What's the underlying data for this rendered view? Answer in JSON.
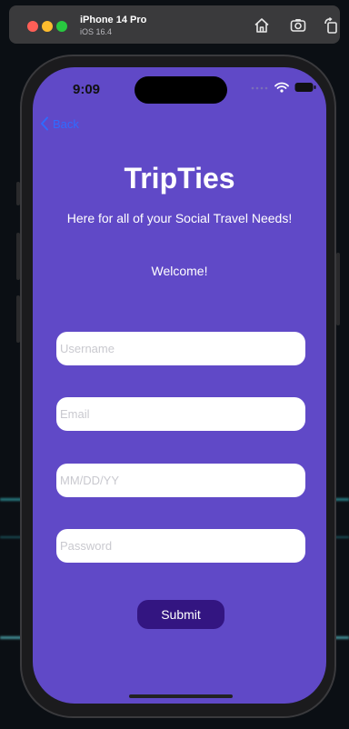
{
  "simulator": {
    "device_name": "iPhone 14 Pro",
    "os_version": "iOS 16.4",
    "icons": [
      "home-icon",
      "screenshot-icon",
      "rotate-icon"
    ]
  },
  "status_bar": {
    "time": "9:09",
    "icons": [
      "signal-dots-icon",
      "wifi-icon",
      "battery-icon"
    ]
  },
  "nav": {
    "back_label": "Back",
    "back_icon": "chevron-left-icon"
  },
  "app": {
    "title": "TripTies",
    "subtitle": "Here for all of your Social Travel Needs!",
    "welcome": "Welcome!"
  },
  "form": {
    "username_placeholder": "Username",
    "email_placeholder": "Email",
    "date_placeholder": "MM/DD/YY",
    "password_placeholder": "Password",
    "submit_label": "Submit"
  },
  "colors": {
    "screen_bg": "#6049c7",
    "submit_bg": "#331581",
    "back_link": "#2f6bff",
    "field_bg": "#ffffff"
  }
}
